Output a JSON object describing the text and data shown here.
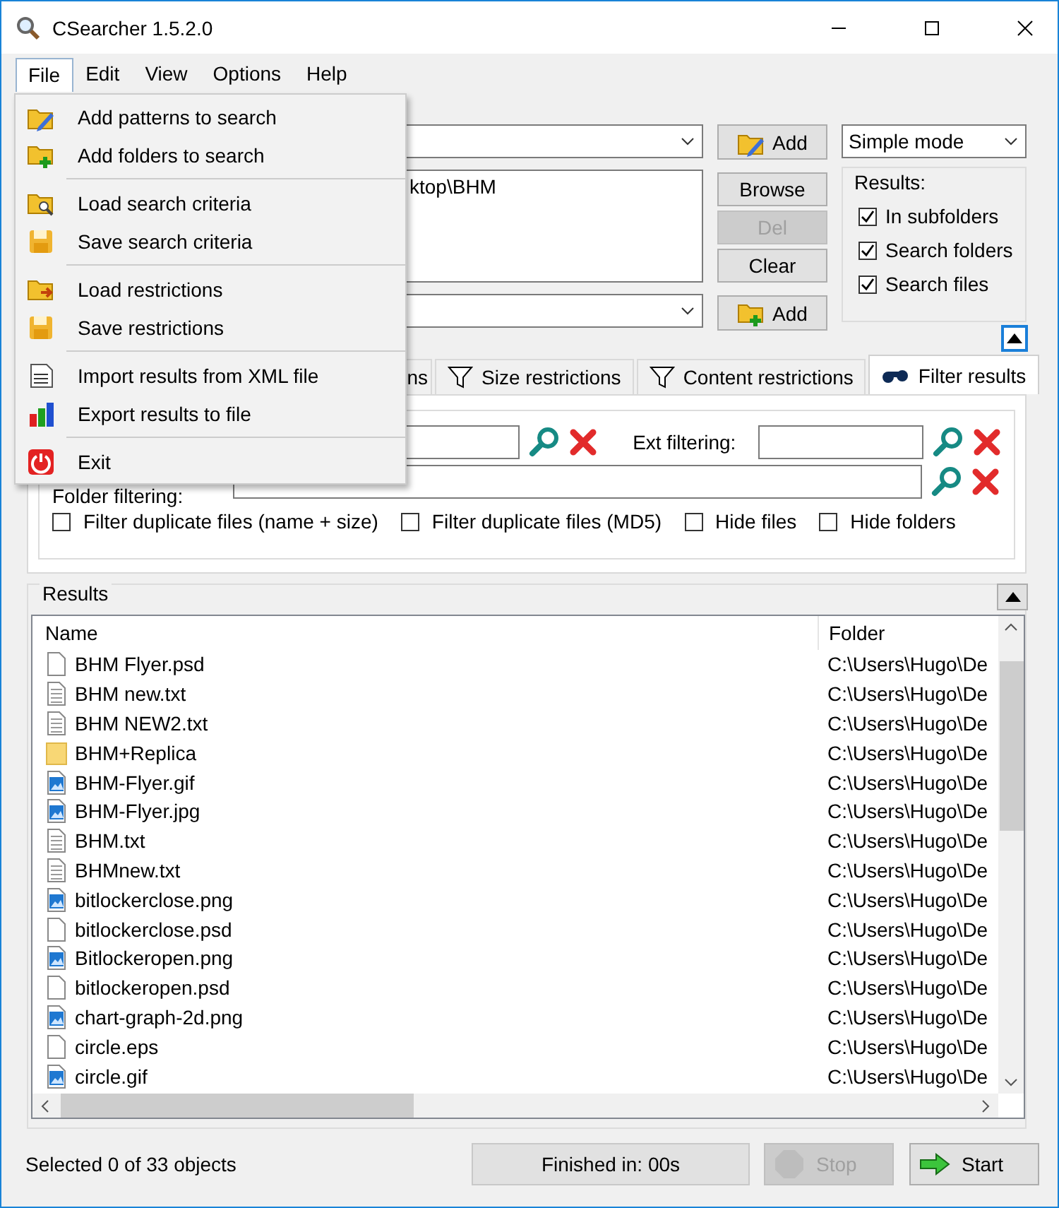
{
  "window": {
    "title": "CSearcher 1.5.2.0"
  },
  "menu_bar": [
    {
      "label": "File",
      "selected": true
    },
    {
      "label": "Edit",
      "selected": false
    },
    {
      "label": "View",
      "selected": false
    },
    {
      "label": "Options",
      "selected": false
    },
    {
      "label": "Help",
      "selected": false
    }
  ],
  "file_menu": {
    "groups": [
      [
        "Add patterns to search",
        "Add folders to search"
      ],
      [
        "Load search criteria",
        "Save search criteria"
      ],
      [
        "Load restrictions",
        "Save restrictions"
      ],
      [
        "Import results from XML file",
        "Export results to file"
      ],
      [
        "Exit"
      ]
    ]
  },
  "search": {
    "pattern_add_button": "Add",
    "mode_select": "Simple mode",
    "folders": [
      "ktop\\BHM"
    ],
    "folder_buttons": [
      {
        "label": "Browse",
        "disabled": false
      },
      {
        "label": "Del",
        "disabled": true
      },
      {
        "label": "Clear",
        "disabled": false
      }
    ],
    "folder_add_button": "Add"
  },
  "results_options": {
    "title": "Results:",
    "options": [
      {
        "label": "In subfolders",
        "checked": true
      },
      {
        "label": "Search folders",
        "checked": true
      },
      {
        "label": "Search files",
        "checked": true
      }
    ]
  },
  "tabs": [
    {
      "label": "ns",
      "selected": false
    },
    {
      "label": "Size restrictions",
      "selected": false
    },
    {
      "label": "Content restrictions",
      "selected": false
    },
    {
      "label": "Filter results",
      "selected": true
    }
  ],
  "filter": {
    "ext_label": "Ext filtering:",
    "folder_label": "Folder filtering:",
    "options": [
      {
        "label": "Filter duplicate files (name + size)",
        "checked": false
      },
      {
        "label": "Filter duplicate files (MD5)",
        "checked": false
      },
      {
        "label": "Hide files",
        "checked": false
      },
      {
        "label": "Hide folders",
        "checked": false
      }
    ]
  },
  "results": {
    "title": "Results",
    "columns": [
      "Name",
      "Folder"
    ],
    "rows": [
      {
        "name": "BHM Flyer.psd",
        "kind": "file",
        "folder": "C:\\Users\\Hugo\\De"
      },
      {
        "name": "BHM new.txt",
        "kind": "text",
        "folder": "C:\\Users\\Hugo\\De"
      },
      {
        "name": "BHM NEW2.txt",
        "kind": "text",
        "folder": "C:\\Users\\Hugo\\De"
      },
      {
        "name": "BHM+Replica",
        "kind": "folder",
        "folder": "C:\\Users\\Hugo\\De"
      },
      {
        "name": "BHM-Flyer.gif",
        "kind": "image",
        "folder": "C:\\Users\\Hugo\\De"
      },
      {
        "name": "BHM-Flyer.jpg",
        "kind": "image",
        "folder": "C:\\Users\\Hugo\\De"
      },
      {
        "name": "BHM.txt",
        "kind": "text",
        "folder": "C:\\Users\\Hugo\\De"
      },
      {
        "name": "BHMnew.txt",
        "kind": "text",
        "folder": "C:\\Users\\Hugo\\De"
      },
      {
        "name": "bitlockerclose.png",
        "kind": "image",
        "folder": "C:\\Users\\Hugo\\De"
      },
      {
        "name": "bitlockerclose.psd",
        "kind": "file",
        "folder": "C:\\Users\\Hugo\\De"
      },
      {
        "name": "Bitlockeropen.png",
        "kind": "image",
        "folder": "C:\\Users\\Hugo\\De"
      },
      {
        "name": "bitlockeropen.psd",
        "kind": "file",
        "folder": "C:\\Users\\Hugo\\De"
      },
      {
        "name": "chart-graph-2d.png",
        "kind": "image",
        "folder": "C:\\Users\\Hugo\\De"
      },
      {
        "name": "circle.eps",
        "kind": "file",
        "folder": "C:\\Users\\Hugo\\De"
      },
      {
        "name": "circle.gif",
        "kind": "image",
        "folder": "C:\\Users\\Hugo\\De"
      }
    ]
  },
  "status": {
    "selection": "Selected 0 of 33 objects",
    "elapsed": "Finished in: 00s",
    "stop": {
      "label": "Stop",
      "disabled": true
    },
    "start": {
      "label": "Start",
      "disabled": false
    }
  }
}
